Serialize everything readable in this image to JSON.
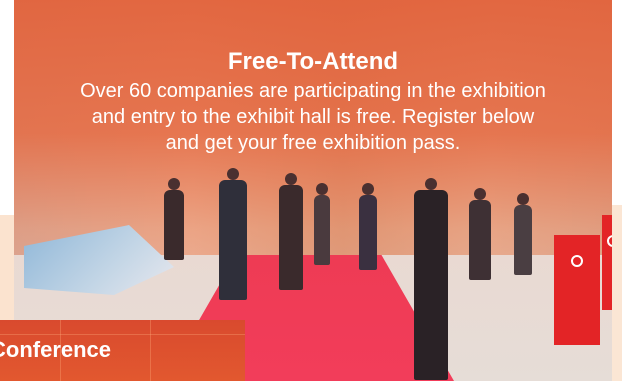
{
  "free_attend": {
    "title": "Free-To-Attend",
    "body": "Over 60 companies are participating in the exhibition and entry to the exhibit hall is free. Register below and get your free exhibition pass."
  },
  "conference": {
    "label": "Conference"
  },
  "colors": {
    "overlay": "#e2603a",
    "carpet": "#f23d5a",
    "stand": "#e32426",
    "conference_tab": "#d94a2e",
    "text": "#ffffff"
  }
}
